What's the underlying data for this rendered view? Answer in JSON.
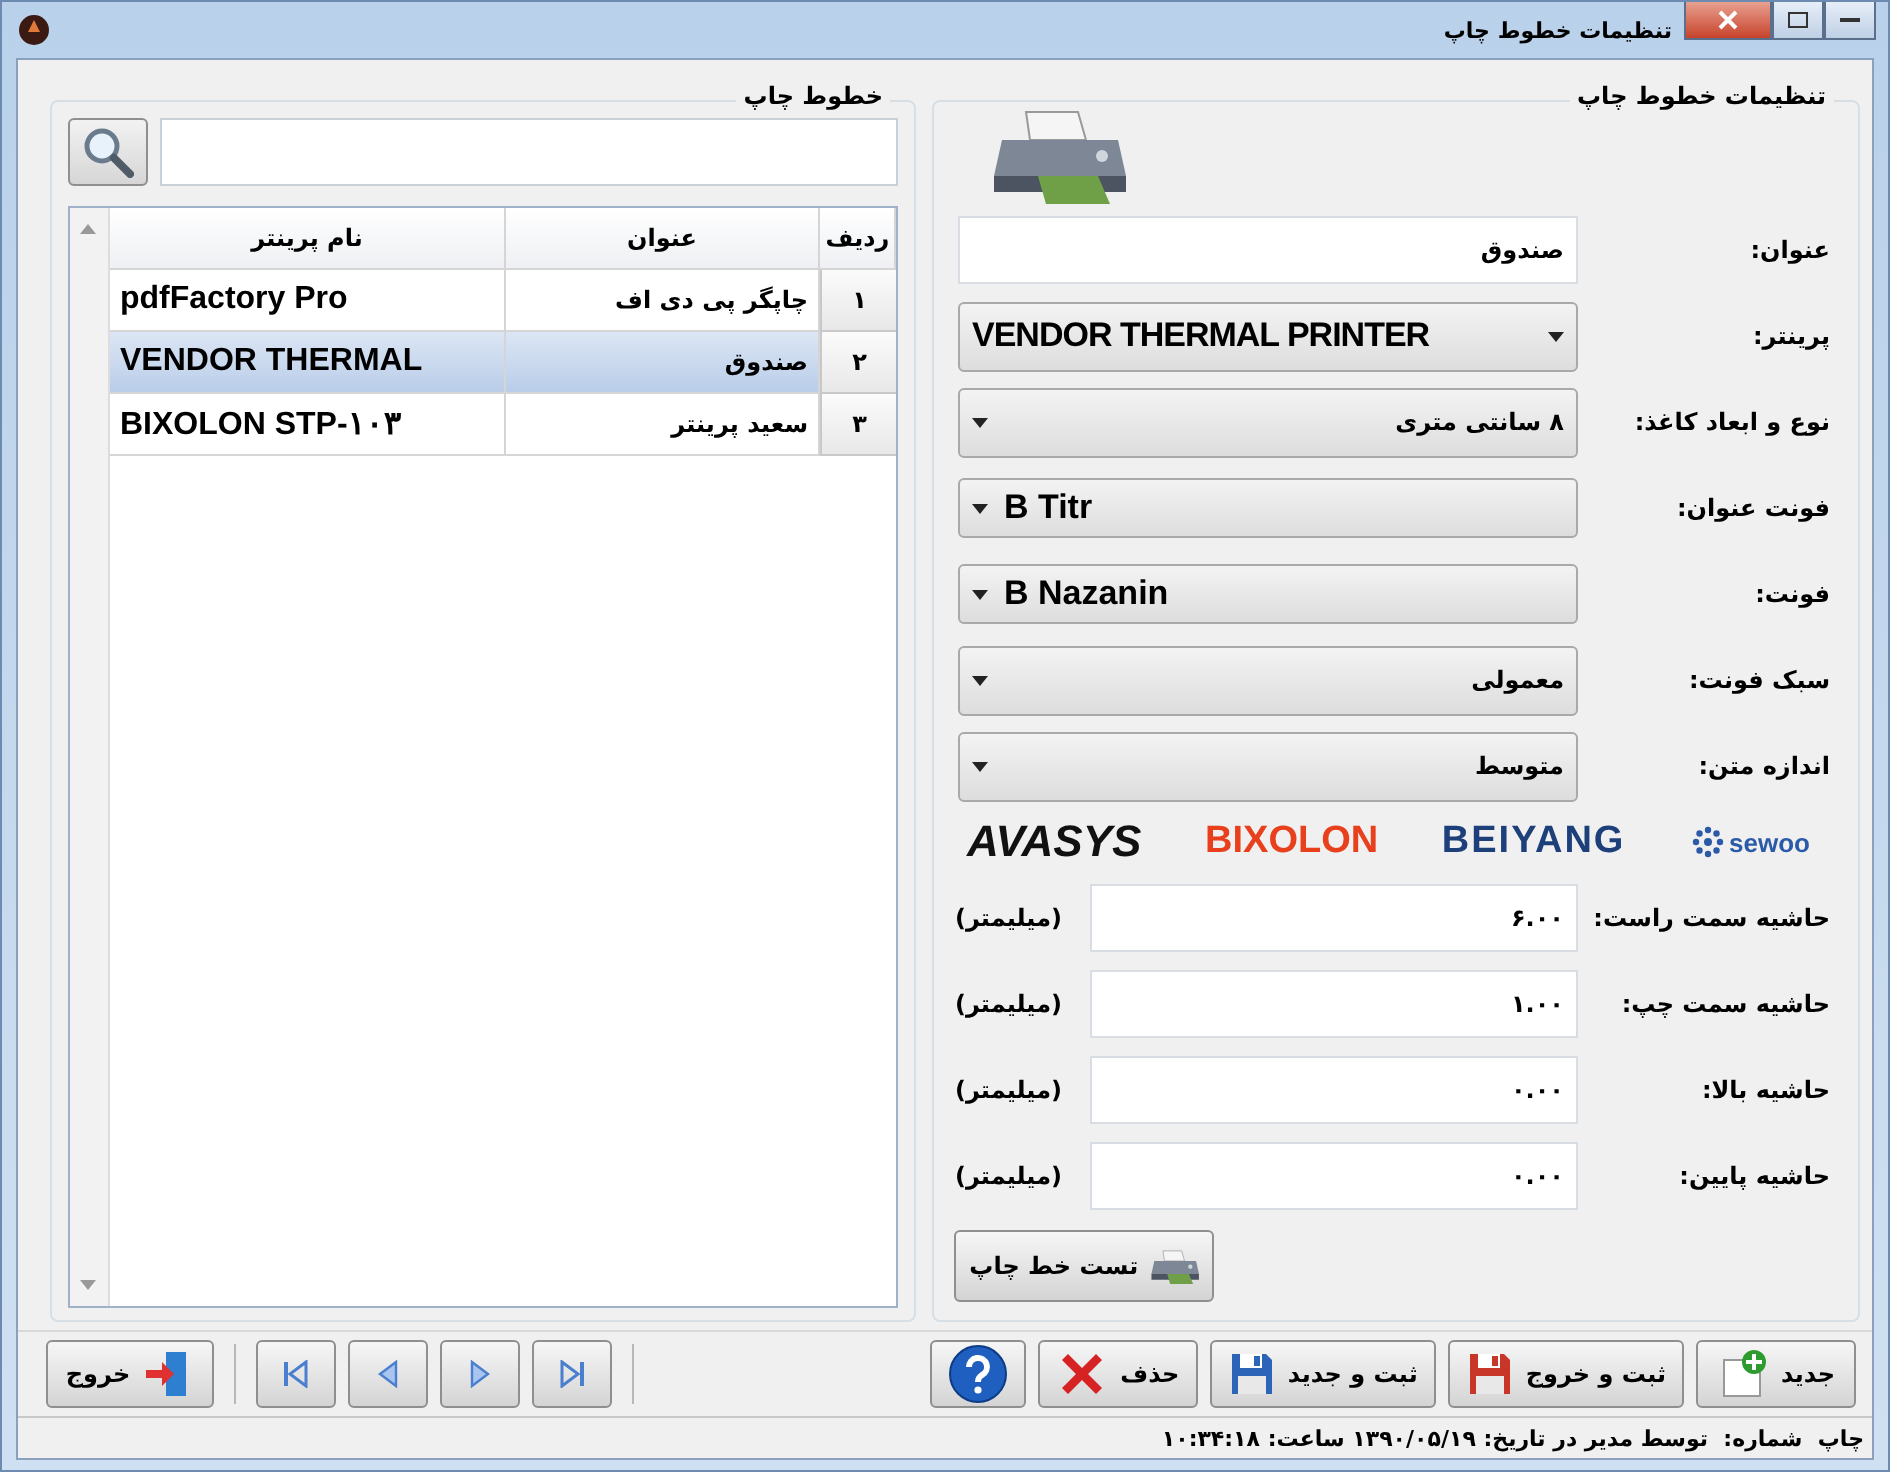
{
  "window": {
    "title": "تنظیمات خطوط چاپ"
  },
  "list_panel": {
    "title": "خطوط چاپ",
    "columns": [
      "ردیف",
      "عنوان",
      "نام پرینتر"
    ],
    "rows": [
      {
        "index": "۱",
        "title": "چاپگر پی دی اف",
        "printer": "pdfFactory Pro",
        "selected": false
      },
      {
        "index": "۲",
        "title": "صندوق",
        "printer": "VENDOR THERMAL",
        "selected": true
      },
      {
        "index": "۳",
        "title": "سعید پرینتر",
        "printer": "BIXOLON STP-۱۰۳",
        "selected": false
      }
    ]
  },
  "settings_panel": {
    "title": "تنظیمات خطوط چاپ",
    "fields": [
      {
        "kind": "text",
        "label": "عنوان:",
        "value": "صندوق"
      },
      {
        "kind": "combo-latin",
        "label": "پرینتر:",
        "value": "VENDOR THERMAL PRINTER"
      },
      {
        "kind": "combo",
        "label": "نوع و ابعاد کاغذ:",
        "value": "۸ سانتی متری"
      },
      {
        "kind": "combo-font",
        "label": "فونت عنوان:",
        "value": "B Titr"
      },
      {
        "kind": "combo-font",
        "label": "فونت:",
        "value": "B Nazanin"
      },
      {
        "kind": "combo",
        "label": "سبک فونت:",
        "value": "معمولی"
      },
      {
        "kind": "combo",
        "label": "اندازه متن:",
        "value": "متوسط"
      }
    ],
    "brands": [
      {
        "name": "sewoo",
        "color": "#2a5aa8"
      },
      {
        "name": "BEIYANG",
        "color": "#1d3f7a"
      },
      {
        "name": "BIXOLON",
        "color": "#e8401c"
      },
      {
        "name": "AVASYS",
        "color": "#111111"
      }
    ],
    "margins": [
      {
        "label": "حاشیه سمت راست:",
        "value": "۶.۰۰",
        "unit": "(میلیمتر)"
      },
      {
        "label": "حاشیه سمت چپ:",
        "value": "۱.۰۰",
        "unit": "(میلیمتر)"
      },
      {
        "label": "حاشیه بالا:",
        "value": "۰.۰۰",
        "unit": "(میلیمتر)"
      },
      {
        "label": "حاشیه پایین:",
        "value": "۰.۰۰",
        "unit": "(میلیمتر)"
      }
    ],
    "test_button": "تست خط چاپ"
  },
  "toolbar": {
    "actions": [
      {
        "kind": "new",
        "label": "جدید"
      },
      {
        "kind": "save-exit",
        "label": "ثبت و خروج"
      },
      {
        "kind": "save-new",
        "label": "ثبت و جدید"
      },
      {
        "kind": "delete",
        "label": "حذف"
      },
      {
        "kind": "help"
      }
    ],
    "navigation": [
      {
        "kind": "first"
      },
      {
        "kind": "previous"
      },
      {
        "kind": "next"
      },
      {
        "kind": "last"
      }
    ],
    "exit": "خروج"
  },
  "status_bar": "چاپ  شماره:  توسط مدیر در تاریخ: ۱۳۹۰/۰۵/۱۹ ساعت: ۱۰:۳۴:۱۸"
}
